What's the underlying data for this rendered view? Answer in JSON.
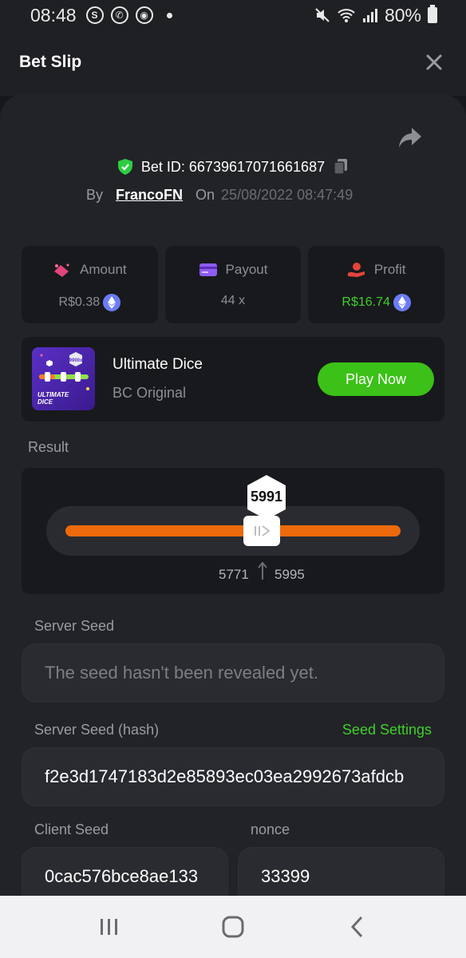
{
  "status_bar": {
    "time": "08:48",
    "battery": "80%",
    "icons": [
      "skype-icon",
      "whatsapp-icon",
      "app-icon",
      "mute-icon",
      "wifi-icon",
      "signal-icon",
      "battery-icon"
    ]
  },
  "header": {
    "title": "Bet Slip",
    "close_icon": "close-icon"
  },
  "bet": {
    "id_label": "Bet ID: 66739617071661687",
    "by_label": "By",
    "user": "FrancoFN",
    "on_label": "On",
    "date": "25/08/2022 08:47:49"
  },
  "stats": {
    "amount_label": "Amount",
    "amount_value": "R$0.38",
    "payout_label": "Payout",
    "payout_value": "44 x",
    "profit_label": "Profit",
    "profit_value": "R$16.74"
  },
  "game": {
    "name": "Ultimate Dice",
    "subtitle": "BC Original",
    "play_label": "Play Now",
    "thumb_text": "ULTIMATE DICE",
    "thumb_badge": "9900x"
  },
  "result": {
    "label": "Result",
    "value": "5991",
    "range_low": "5771",
    "range_high": "5995"
  },
  "seeds": {
    "server_seed_label": "Server Seed",
    "server_seed_value": "The seed hasn't been revealed yet.",
    "server_hash_label": "Server Seed (hash)",
    "seed_settings_label": "Seed Settings",
    "server_hash_value": "f2e3d1747183d2e85893ec03ea2992673afdcb",
    "client_seed_label": "Client Seed",
    "client_seed_value": "0cac576bce8ae133",
    "nonce_label": "nonce",
    "nonce_value": "33399"
  },
  "colors": {
    "accent_green": "#3bc117",
    "track_orange": "#ec6a0c",
    "eth_blue": "#6b7cf5",
    "shield_green": "#2ecc40"
  }
}
